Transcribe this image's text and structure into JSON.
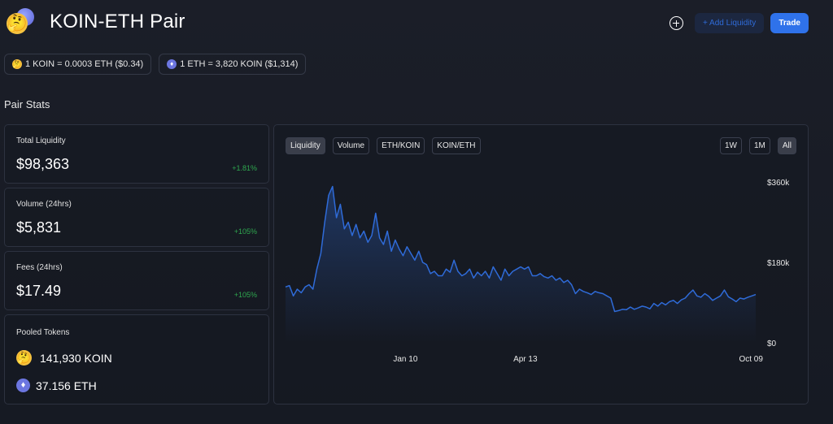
{
  "header": {
    "title": "KOIN-ETH Pair",
    "add_liquidity_label": "+ Add Liquidity",
    "trade_label": "Trade"
  },
  "prices": [
    {
      "text": "1 KOIN = 0.0003 ETH ($0.34)",
      "icon": "koin-token-icon"
    },
    {
      "text": "1 ETH = 3,820 KOIN ($1,314)",
      "icon": "eth-token-icon"
    }
  ],
  "section_title": "Pair Stats",
  "stats": [
    {
      "label": "Total Liquidity",
      "value": "$98,363",
      "change": "+1.81%"
    },
    {
      "label": "Volume (24hrs)",
      "value": "$5,831",
      "change": "+105%"
    },
    {
      "label": "Fees (24hrs)",
      "value": "$17.49",
      "change": "+105%"
    }
  ],
  "pooled": {
    "label": "Pooled Tokens",
    "koin": "141,930 KOIN",
    "eth": "37.156 ETH"
  },
  "chart": {
    "tabs": [
      "Liquidity",
      "Volume",
      "ETH/KOIN",
      "KOIN/ETH"
    ],
    "active_tab": "Liquidity",
    "ranges": [
      "1W",
      "1M",
      "All"
    ],
    "active_range": "All"
  },
  "colors": {
    "accent": "#2f72ea",
    "positive": "#2fa84f",
    "line": "#2f6bd8",
    "background": "#181b24"
  },
  "chart_data": {
    "type": "area",
    "title": "",
    "xlabel": "",
    "ylabel": "",
    "x_ticks": [
      "Jan 10",
      "Apr 13",
      "Oct 09"
    ],
    "y_ticks": [
      "$0",
      "$180k",
      "$360k"
    ],
    "ylim": [
      0,
      360000
    ],
    "grid": false,
    "series": [
      {
        "values": [
          125000,
          128000,
          105000,
          120000,
          112000,
          125000,
          130000,
          120000,
          165000,
          200000,
          270000,
          330000,
          350000,
          280000,
          310000,
          255000,
          270000,
          240000,
          265000,
          235000,
          250000,
          225000,
          240000,
          290000,
          235000,
          220000,
          250000,
          205000,
          230000,
          210000,
          195000,
          215000,
          200000,
          185000,
          205000,
          180000,
          175000,
          155000,
          160000,
          150000,
          150000,
          165000,
          158000,
          185000,
          160000,
          150000,
          155000,
          165000,
          145000,
          158000,
          150000,
          160000,
          145000,
          170000,
          155000,
          140000,
          165000,
          150000,
          160000,
          165000,
          170000,
          165000,
          170000,
          150000,
          150000,
          155000,
          148000,
          145000,
          150000,
          140000,
          145000,
          135000,
          140000,
          130000,
          110000,
          120000,
          115000,
          112000,
          108000,
          115000,
          112000,
          110000,
          105000,
          100000,
          70000,
          72000,
          75000,
          74000,
          80000,
          75000,
          78000,
          82000,
          80000,
          76000,
          88000,
          82000,
          90000,
          85000,
          92000,
          95000,
          88000,
          96000,
          100000,
          110000,
          118000,
          105000,
          102000,
          110000,
          104000,
          95000,
          100000,
          105000,
          118000,
          103000,
          98000,
          92000,
          100000,
          98000,
          102000,
          105000,
          108000
        ]
      }
    ]
  }
}
